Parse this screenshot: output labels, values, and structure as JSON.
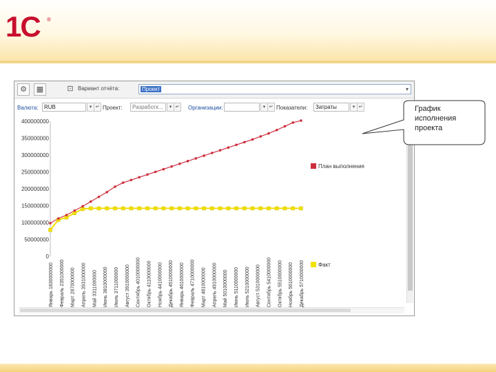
{
  "logo": {
    "text": "1С",
    "reg": "®"
  },
  "toolbar": {
    "settings_icon": "gear-icon",
    "chart_icon": "chart-icon",
    "help_icon": "help-icon",
    "variant_label": "Вариант отчёта:",
    "variant_value": "Проект",
    "dropdown_icon": "chevron-down-icon"
  },
  "filters": [
    {
      "label": "Валюта:",
      "value": "RUB"
    },
    {
      "label": "Проект:",
      "value": "Разработк..."
    },
    {
      "label": "Организации:",
      "value": ""
    },
    {
      "label": "Показатели:",
      "value": "Затраты"
    }
  ],
  "callout": {
    "text": "График исполнения проекта"
  },
  "colors": {
    "plan": "#cc2e3b",
    "fact": "#f2e000",
    "accent": "#c8102e"
  },
  "chart_data": {
    "type": "line",
    "ylim": [
      0,
      400000000
    ],
    "y_ticks": [
      "400000000",
      "350000000",
      "300000000",
      "250000000",
      "200000000",
      "150000000",
      "100000000",
      "50000000",
      "0"
    ],
    "y_tick_values": [
      400000000,
      350000000,
      300000000,
      250000000,
      200000000,
      150000000,
      100000000,
      50000000,
      0
    ],
    "categories": [
      "Январь 1830000000",
      "Февраль 2351000000",
      "Март 2870000000",
      "Апрель 3931000000",
      "Май 3311000000",
      "Июнь 3810000000",
      "Июль 3711000000",
      "Август 3910000000",
      "Сентябрь 4010000000",
      "Октябрь 4110000000",
      "Ноябрь 4410000000",
      "Декабрь 4510000000",
      "Январь 4610000000",
      "Февраль 4710000000",
      "Март 4810000000",
      "Апрель 4910000000",
      "Май 5010000000",
      "Июнь 5110000000",
      "Июль 5210000000",
      "Август 5310000000",
      "Сентябрь 5410000000",
      "Октябрь 5510000000",
      "Ноябрь 5610000000",
      "Декабрь 5710000000"
    ],
    "series": [
      {
        "name": "План выполнения",
        "values": [
          98000000,
          112000000,
          122000000,
          135000000,
          148000000,
          162000000,
          176000000,
          190000000,
          206000000,
          218000000,
          226000000,
          234000000,
          242000000,
          250000000,
          258000000,
          266000000,
          274000000,
          282000000,
          290000000,
          298000000,
          306000000,
          314000000,
          322000000,
          330000000,
          338000000,
          346000000,
          355000000,
          364000000,
          374000000,
          385000000,
          396000000,
          402000000
        ]
      },
      {
        "name": "Факт",
        "values": [
          78000000,
          108000000,
          115000000,
          128000000,
          140000000,
          142000000,
          142000000,
          142000000,
          142000000,
          142000000,
          142000000,
          142000000,
          142000000,
          142000000,
          142000000,
          142000000,
          142000000,
          142000000,
          142000000,
          142000000,
          142000000,
          142000000,
          142000000,
          142000000,
          142000000,
          142000000,
          142000000,
          142000000,
          142000000,
          142000000,
          142000000,
          142000000
        ]
      }
    ],
    "legend_position": "right",
    "grid": false
  }
}
